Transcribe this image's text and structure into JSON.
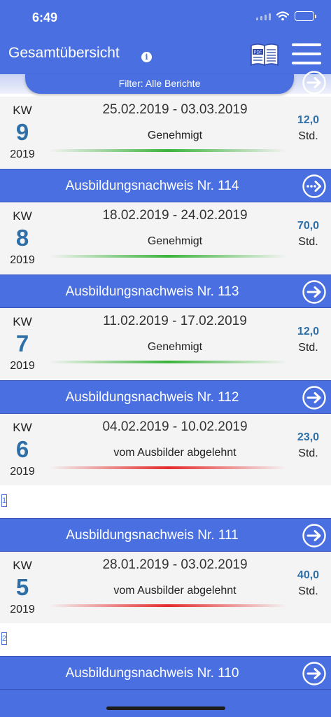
{
  "status_bar": {
    "time": "6:49"
  },
  "navbar": {
    "title": "Gesamtübersicht",
    "info_glyph": "i",
    "pdf_label": "PDF"
  },
  "filter": {
    "label": "Filter: Alle Berichte"
  },
  "colors": {
    "accent": "#4a6fe0",
    "number": "#2e6fa8",
    "approved": "#3bb33b",
    "rejected": "#e52b2b"
  },
  "reports": [
    {
      "kw_label": "KW",
      "kw": "9",
      "year": "2019",
      "dates": "25.02.2019 - 03.03.2019",
      "status": "Genehmigt",
      "status_type": "approved",
      "hours": "12,0",
      "hours_unit": "Std."
    },
    {
      "title": "Ausbildungsnachweis Nr. 114",
      "icon": "more-arrow-icon",
      "kw_label": "KW",
      "kw": "8",
      "year": "2019",
      "dates": "18.02.2019 - 24.02.2019",
      "status": "Genehmigt",
      "status_type": "approved",
      "hours": "70,0",
      "hours_unit": "Std."
    },
    {
      "title": "Ausbildungsnachweis Nr. 113",
      "icon": "arrow-right-icon",
      "kw_label": "KW",
      "kw": "7",
      "year": "2019",
      "dates": "11.02.2019 - 17.02.2019",
      "status": "Genehmigt",
      "status_type": "approved",
      "hours": "12,0",
      "hours_unit": "Std."
    },
    {
      "title": "Ausbildungsnachweis Nr. 112",
      "icon": "arrow-right-icon",
      "kw_label": "KW",
      "kw": "6",
      "year": "2019",
      "dates": "04.02.2019 - 10.02.2019",
      "status": "vom Ausbilder abgelehnt",
      "status_type": "rejected",
      "hours": "23,0",
      "hours_unit": "Std.",
      "marker": "1"
    },
    {
      "title": "Ausbildungsnachweis Nr. 111",
      "icon": "arrow-right-icon",
      "kw_label": "KW",
      "kw": "5",
      "year": "2019",
      "dates": "28.01.2019 - 03.02.2019",
      "status": "vom Ausbilder abgelehnt",
      "status_type": "rejected",
      "hours": "40,0",
      "hours_unit": "Std.",
      "marker": "2"
    },
    {
      "title": "Ausbildungsnachweis Nr. 110",
      "icon": "arrow-right-icon"
    }
  ]
}
